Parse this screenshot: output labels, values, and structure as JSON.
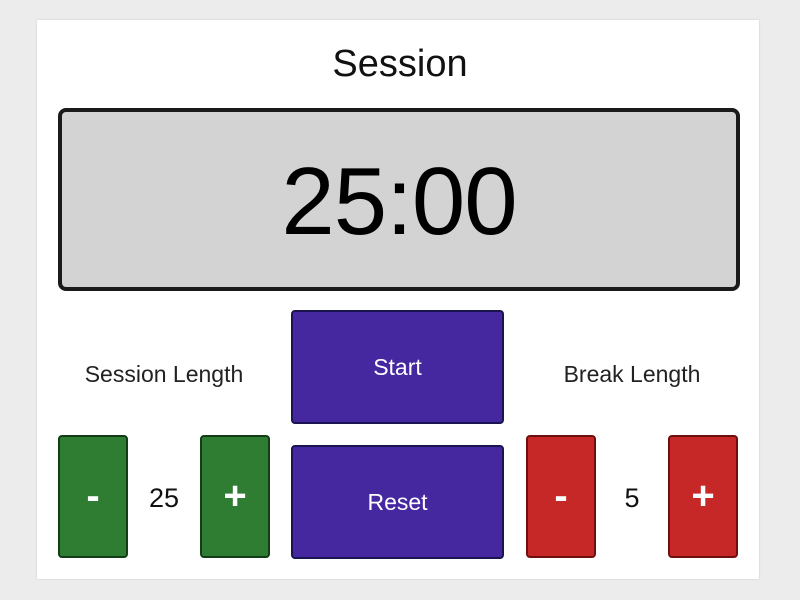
{
  "header": {
    "title": "Session"
  },
  "timer": {
    "display": "25:00"
  },
  "session": {
    "label": "Session Length",
    "decrement_label": "-",
    "increment_label": "+",
    "value": "25"
  },
  "break": {
    "label": "Break Length",
    "decrement_label": "-",
    "increment_label": "+",
    "value": "5"
  },
  "controls": {
    "start_label": "Start",
    "reset_label": "Reset"
  },
  "colors": {
    "primary": "#4527a0",
    "session_buttons": "#2e7d32",
    "break_buttons": "#c62828",
    "display_bg": "#d3d3d3"
  }
}
